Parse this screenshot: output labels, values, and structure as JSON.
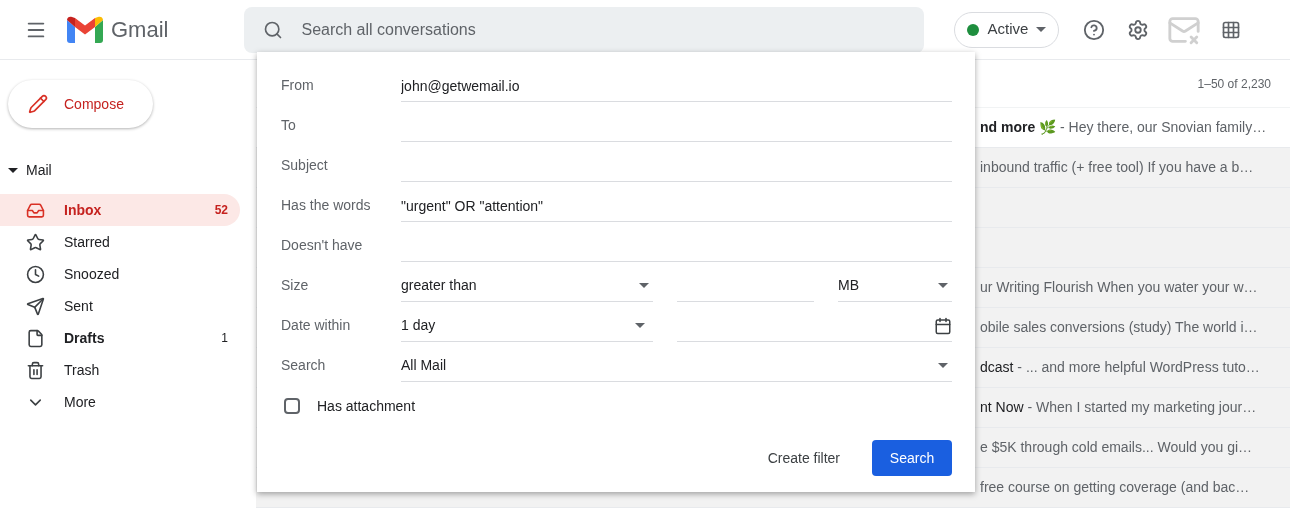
{
  "header": {
    "app_name": "Gmail",
    "search_placeholder": "Search all conversations",
    "status": {
      "label": "Active",
      "color": "#1e8e3e"
    }
  },
  "compose": "Compose",
  "sidebar": {
    "section": "Mail",
    "expanded": true,
    "items": [
      {
        "label": "Inbox",
        "count": "52",
        "selected": true,
        "bold": true
      },
      {
        "label": "Starred",
        "selected": false,
        "bold": false
      },
      {
        "label": "Snoozed",
        "selected": false,
        "bold": false
      },
      {
        "label": "Sent",
        "selected": false,
        "bold": false
      },
      {
        "label": "Drafts",
        "count": "1",
        "selected": false,
        "bold": true
      },
      {
        "label": "Trash",
        "selected": false,
        "bold": false
      },
      {
        "label": "More",
        "selected": false,
        "bold": false
      }
    ]
  },
  "pagination": "1–50 of 2,230",
  "rows": [
    {
      "unread": true,
      "lead": "nd more 🌿",
      "snippet": " - Hey there, our Snovian family…"
    },
    {
      "unread": false,
      "snippet": "inbound traffic (+ free tool) If you have a b…"
    },
    {
      "unread": false
    },
    {
      "unread": false
    },
    {
      "unread": false,
      "snippet": "ur Writing Flourish When you water your w…"
    },
    {
      "unread": false,
      "snippet": "obile sales conversions (study) The world i…"
    },
    {
      "unread": false,
      "lead": "dcast",
      "snippet": " - ... and more helpful WordPress tuto…"
    },
    {
      "unread": false,
      "lead": "nt Now",
      "snippet": " - When I started my marketing jour…"
    },
    {
      "unread": false,
      "snippet": "e $5K through cold emails... Would you gi…"
    },
    {
      "unread": false,
      "snippet": "free course on getting coverage (and bac…"
    }
  ],
  "search_dialog": {
    "fields": [
      {
        "kind": "text",
        "label": "From",
        "value": "john@getwemail.io"
      },
      {
        "kind": "text",
        "label": "To"
      },
      {
        "kind": "text",
        "label": "Subject"
      },
      {
        "kind": "text",
        "label": "Has the words",
        "value": "\"urgent\" OR \"attention\""
      },
      {
        "kind": "text",
        "label": "Doesn't have"
      },
      {
        "kind": "size",
        "label": "Size",
        "operator": "greater than",
        "unit": "MB"
      },
      {
        "kind": "date",
        "label": "Date within",
        "range": "1 day"
      },
      {
        "kind": "select",
        "label": "Search",
        "value": "All Mail"
      }
    ],
    "has_attachment": {
      "label": "Has attachment",
      "checked": false
    },
    "create_filter": "Create filter",
    "search_button": "Search"
  }
}
